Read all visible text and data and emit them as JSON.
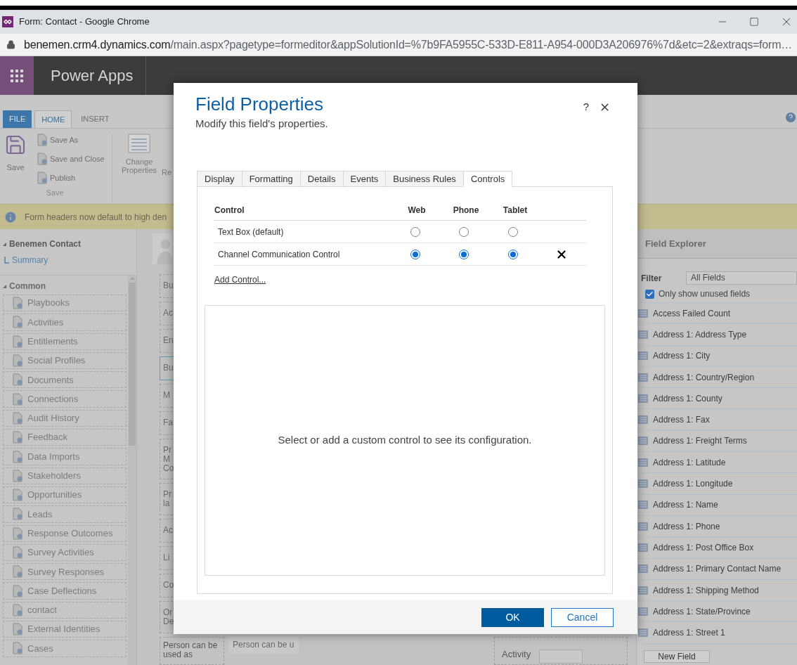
{
  "browser": {
    "title": "Form: Contact - Google Chrome",
    "url_host": "benemen.crm4.dynamics.com",
    "url_path": "/main.aspx?pagetype=formeditor&appSolutionId=%7b9FA5955C-533D-E811-A954-000D3A206976%7d&etc=2&extraqs=form…"
  },
  "app": {
    "name": "Power Apps"
  },
  "ribbon": {
    "tabs": [
      {
        "label": "FILE",
        "kind": "file",
        "selected": false
      },
      {
        "label": "HOME",
        "kind": "tab",
        "selected": true
      },
      {
        "label": "INSERT",
        "kind": "tab",
        "selected": false
      }
    ],
    "save_group": {
      "main": "Save",
      "commands": [
        "Save As",
        "Save and Close",
        "Publish"
      ],
      "label": "Save"
    },
    "change_properties": "Change\nProperties",
    "cut_command": "Re"
  },
  "notice": "Form headers now default to high den",
  "nav": {
    "title": "Benemen Contact",
    "summary": "Summary",
    "section": "Common",
    "items": [
      "Playbooks",
      "Activities",
      "Entitlements",
      "Social Profiles",
      "Documents",
      "Connections",
      "Audit History",
      "Feedback",
      "Data Imports",
      "Stakeholders",
      "Opportunities",
      "Leads",
      "Response Outcomes",
      "Survey Activities",
      "Survey Responses",
      "Case Deflections",
      "contact",
      "External Identities",
      "Cases"
    ]
  },
  "form_fields": [
    {
      "text": "Bu",
      "selected": false
    },
    {
      "text": "Ac",
      "selected": false
    },
    {
      "text": "En",
      "selected": false
    },
    {
      "text": "Bu",
      "selected": true
    },
    {
      "text": "M",
      "selected": false
    },
    {
      "text": "Fa",
      "selected": false
    },
    {
      "text": "Pr\nM\nCo",
      "selected": false
    },
    {
      "text": "Pr\nla",
      "selected": false
    },
    {
      "text": "Ac",
      "selected": false
    },
    {
      "text": "Li",
      "selected": false
    },
    {
      "text": "Co",
      "selected": false
    },
    {
      "text": "Or\nDe",
      "selected": false
    }
  ],
  "bottom_row": {
    "label": "Person can be\nused as",
    "value": "Person can be u",
    "activity": "Activity"
  },
  "field_explorer": {
    "title": "Field Explorer",
    "filter_label": "Filter",
    "filter_value": "All Fields",
    "unused_only": {
      "label": "Only show unused fields",
      "checked": true
    },
    "fields": [
      "Access Failed Count",
      "Address 1: Address Type",
      "Address 1: City",
      "Address 1: Country/Region",
      "Address 1: County",
      "Address 1: Fax",
      "Address 1: Freight Terms",
      "Address 1: Latitude",
      "Address 1: Longitude",
      "Address 1: Name",
      "Address 1: Phone",
      "Address 1: Post Office Box",
      "Address 1: Primary Contact Name",
      "Address 1: Shipping Method",
      "Address 1: State/Province",
      "Address 1: Street 1"
    ],
    "new_field": "New Field"
  },
  "dialog": {
    "title": "Field Properties",
    "subtitle": "Modify this field's properties.",
    "help": "?",
    "tabs": [
      {
        "label": "Display",
        "selected": false
      },
      {
        "label": "Formatting",
        "selected": false
      },
      {
        "label": "Details",
        "selected": false
      },
      {
        "label": "Events",
        "selected": false
      },
      {
        "label": "Business Rules",
        "selected": false
      },
      {
        "label": "Controls",
        "selected": true
      }
    ],
    "controls": {
      "columns": [
        "Control",
        "Web",
        "Phone",
        "Tablet"
      ],
      "rows": [
        {
          "name": "Text Box (default)",
          "removable": false,
          "targets": [
            {
              "selected": false
            },
            {
              "selected": false
            },
            {
              "selected": false
            }
          ]
        },
        {
          "name": "Channel Communication Control",
          "removable": true,
          "targets": [
            {
              "selected": true
            },
            {
              "selected": true
            },
            {
              "selected": true
            }
          ]
        }
      ]
    },
    "add_link": "Add Control...",
    "message": "Select or add a custom control to see its configuration.",
    "buttons": [
      {
        "label": "OK",
        "kind": "primary"
      },
      {
        "label": "Cancel",
        "kind": "secondary"
      }
    ]
  }
}
